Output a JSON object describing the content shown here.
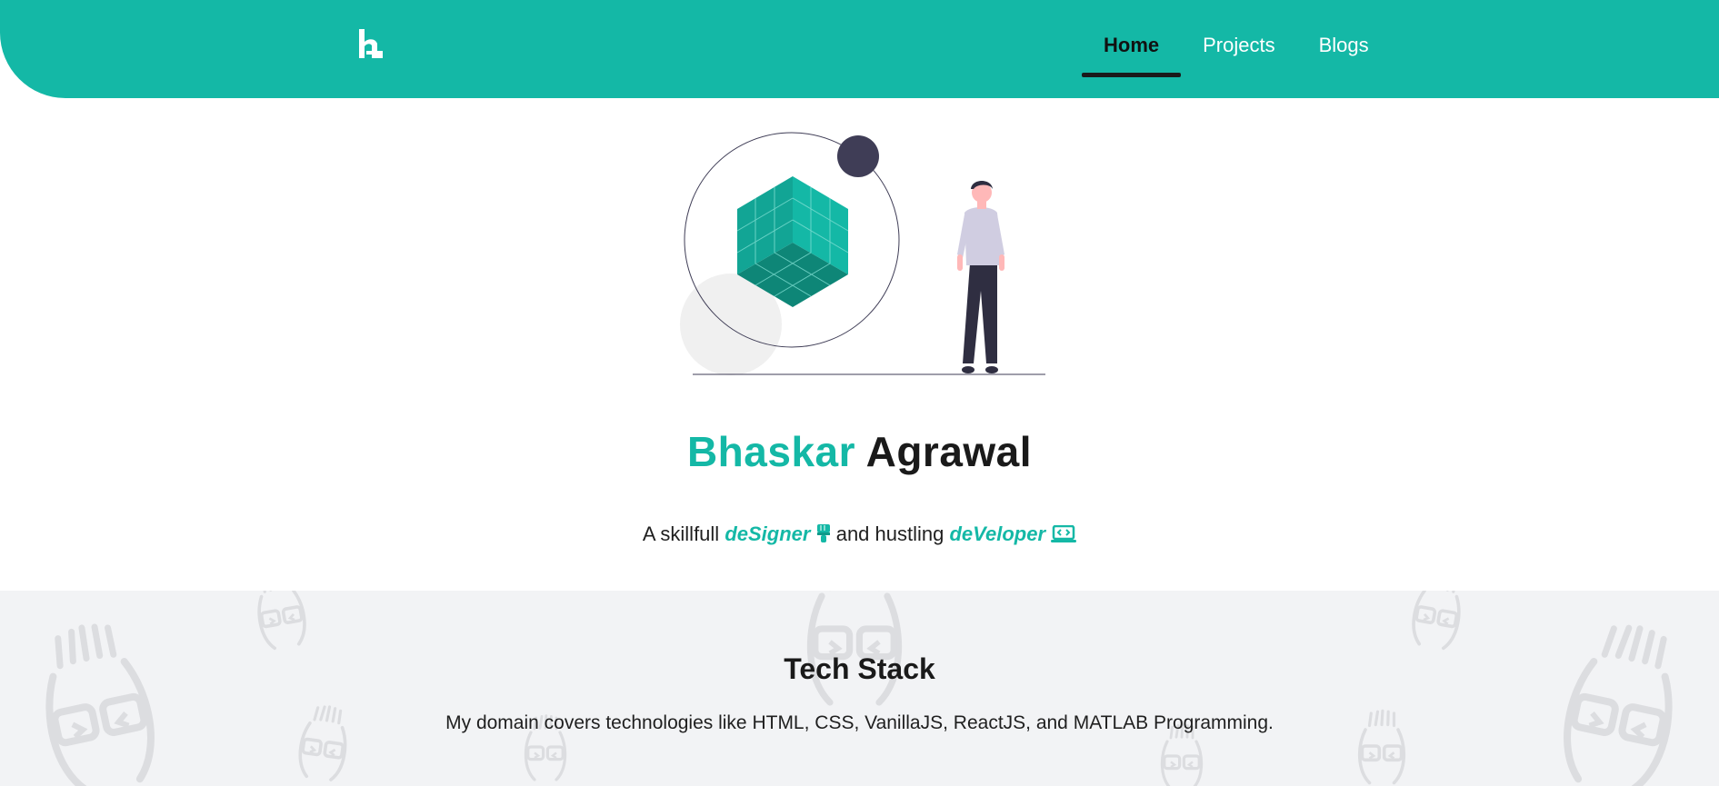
{
  "nav": {
    "logo_icon": "bh-monogram-logo",
    "links": [
      {
        "label": "Home",
        "active": true
      },
      {
        "label": "Projects",
        "active": false
      },
      {
        "label": "Blogs",
        "active": false
      }
    ]
  },
  "hero": {
    "illustration": "person-with-cube-illustration",
    "first_name": "Bhaskar",
    "last_name": "Agrawal",
    "tagline": {
      "prefix": "A skillfull",
      "designer": "deSigner",
      "designer_icon": "paintbrush-icon",
      "middle": "and hustling",
      "developer": "deVeloper",
      "developer_icon": "laptop-code-icon"
    }
  },
  "tech_stack": {
    "title": "Tech Stack",
    "description": "My domain covers technologies like HTML, CSS, VanillaJS, ReactJS, and MATLAB Programming."
  },
  "colors": {
    "accent": "#14b8a6",
    "dark": "#1a1a1a",
    "section_bg": "#f2f3f5"
  }
}
